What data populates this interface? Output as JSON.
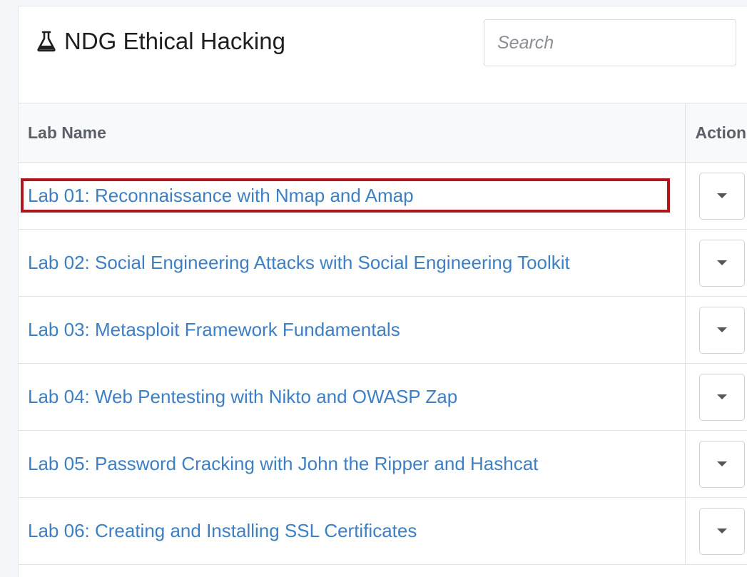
{
  "header": {
    "title": "NDG Ethical Hacking",
    "title_icon": "flask-icon"
  },
  "search": {
    "placeholder": "Search",
    "value": ""
  },
  "table": {
    "columns": [
      "Lab Name",
      "Action"
    ],
    "rows": [
      {
        "name": "Lab 01: Reconnaissance with Nmap and Amap",
        "highlighted": true
      },
      {
        "name": "Lab 02: Social Engineering Attacks with Social Engineering Toolkit",
        "highlighted": false
      },
      {
        "name": "Lab 03: Metasploit Framework Fundamentals",
        "highlighted": false
      },
      {
        "name": "Lab 04: Web Pentesting with Nikto and OWASP Zap",
        "highlighted": false
      },
      {
        "name": "Lab 05: Password Cracking with John the Ripper and Hashcat",
        "highlighted": false
      },
      {
        "name": "Lab 06: Creating and Installing SSL Certificates",
        "highlighted": false
      }
    ]
  },
  "colors": {
    "link": "#3e7fc4",
    "highlight_border": "#b0171c"
  }
}
